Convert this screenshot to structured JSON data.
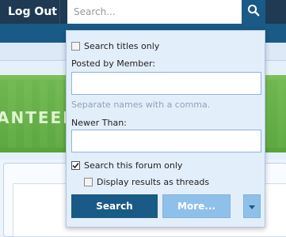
{
  "header": {
    "logout_label": "Log Out",
    "search_placeholder": "Search..."
  },
  "banner": {
    "partial_text": "ANTEED"
  },
  "search_panel": {
    "titles_only": {
      "label": "Search titles only",
      "checked": false
    },
    "posted_by": {
      "label": "Posted by Member:",
      "value": "",
      "hint": "Separate names with a comma."
    },
    "newer_than": {
      "label": "Newer Than:",
      "value": ""
    },
    "this_forum_only": {
      "label": "Search this forum only",
      "checked": true
    },
    "display_threads": {
      "label": "Display results as threads",
      "checked": false
    },
    "search_button": "Search",
    "more_button": "More..."
  },
  "colors": {
    "header_bg": "#1f3a52",
    "accent": "#1a5a86",
    "panel_bg": "#e3eefb",
    "button_light": "#8fc0ea",
    "banner_green": "#6ab24c"
  },
  "icons": [
    "search-icon",
    "checkmark-icon",
    "chevron-down-icon"
  ]
}
